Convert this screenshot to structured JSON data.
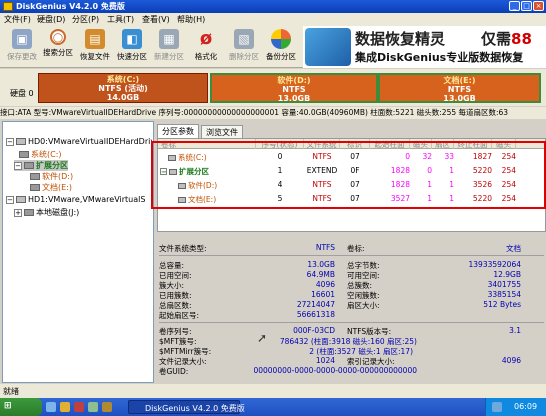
{
  "window": {
    "title": "DiskGenius V4.2.0 免费版"
  },
  "menu": [
    "文件(F)",
    "硬盘(D)",
    "分区(P)",
    "工具(T)",
    "查看(V)",
    "帮助(H)"
  ],
  "toolbar": [
    {
      "label": "保存更改",
      "icon": "save-icon",
      "color": "#8fa5c6",
      "enabled": false
    },
    {
      "label": "搜索分区",
      "icon": "magnifier-icon",
      "color": "#c96a2e",
      "enabled": true
    },
    {
      "label": "恢复文件",
      "icon": "folder-recover-icon",
      "color": "#d38b2c",
      "enabled": true
    },
    {
      "label": "快速分区",
      "icon": "quick-partition-icon",
      "color": "#3a8fd3",
      "enabled": true
    },
    {
      "label": "新建分区",
      "icon": "new-partition-icon",
      "color": "#9aa7b4",
      "enabled": false
    },
    {
      "label": "格式化",
      "icon": "format-icon",
      "color": "#d32020",
      "enabled": true
    },
    {
      "label": "删除分区",
      "icon": "delete-partition-icon",
      "color": "#9aa7b4",
      "enabled": false
    },
    {
      "label": "备份分区",
      "icon": "backup-partition-icon",
      "color": "#d4a31c",
      "enabled": true
    }
  ],
  "banner": {
    "line1": "数据恢复精灵",
    "line2_a": "仅需",
    "line2_b": "88",
    "line3": "集成DiskGenius专业版数据恢复"
  },
  "diskmap": {
    "disk_label": "硬盘 0",
    "partitions": [
      {
        "name": "系统(C:)",
        "fs": "NTFS (活动)",
        "size": "14.0GB",
        "color": "#c0531c"
      },
      {
        "name": "软件(D:)",
        "fs": "NTFS",
        "size": "13.0GB",
        "color": "#d6621e"
      },
      {
        "name": "文档(E:)",
        "fs": "NTFS",
        "size": "13.0GB",
        "color": "#d6621e"
      }
    ]
  },
  "infoline": "接口:ATA  型号:VMwareVirtualIDEHardDrive  序列号:00000000000000000001  容量:40.0GB(40960MB)  柱面数:5221  磁头数:255  每道扇区数:63",
  "tree": {
    "disk0": "HD0:VMwareVirtualIDEHardDrive",
    "c": "系统(C:)",
    "ext": "扩展分区",
    "d": "软件(D:)",
    "e": "文档(E:)",
    "disk1": "HD1:VMware,VMwareVirtualS",
    "local": "本地磁盘(J:)"
  },
  "tabs": [
    "分区参数",
    "浏览文件"
  ],
  "grid": {
    "headers": [
      "卷标",
      "序号(状态)",
      "文件系统",
      "标识",
      "起始柱面",
      "磁头",
      "扇区",
      "终止柱面",
      "磁头"
    ],
    "rows": [
      {
        "name": "系统(C:)",
        "no": "0",
        "fs": "NTFS",
        "id": "07",
        "sc": "0",
        "sh": "32",
        "ss": "33",
        "ec": "1827",
        "eh": "254"
      },
      {
        "name": "扩展分区",
        "no": "1",
        "fs": "EXTEND",
        "id": "0F",
        "sc": "1828",
        "sh": "0",
        "ss": "1",
        "ec": "5220",
        "eh": "254"
      },
      {
        "name": "软件(D:)",
        "no": "4",
        "fs": "NTFS",
        "id": "07",
        "sc": "1828",
        "sh": "1",
        "ss": "1",
        "ec": "3526",
        "eh": "254"
      },
      {
        "name": "文档(E:)",
        "no": "5",
        "fs": "NTFS",
        "id": "07",
        "sc": "3527",
        "sh": "1",
        "ss": "1",
        "ec": "5220",
        "eh": "254"
      }
    ]
  },
  "details": {
    "fs_type_label": "文件系统类型:",
    "fs_type": "NTFS",
    "vol_label": "卷标:",
    "vol": "文档",
    "rows1": [
      {
        "l": "总容量:",
        "v": "13.0GB",
        "l2": "总字节数:",
        "v2": "13933592064"
      },
      {
        "l": "已用空间:",
        "v": "64.9MB",
        "l2": "可用空间:",
        "v2": "12.9GB"
      },
      {
        "l": "簇大小:",
        "v": "4096",
        "l2": "总簇数:",
        "v2": "3401755"
      },
      {
        "l": "已用簇数:",
        "v": "16601",
        "l2": "空闲簇数:",
        "v2": "3385154"
      },
      {
        "l": "总扇区数:",
        "v": "27214047",
        "l2": "扇区大小:",
        "v2": "512 Bytes"
      },
      {
        "l": "起始扇区号:",
        "v": "56661318",
        "l2": "",
        "v2": ""
      }
    ],
    "rows2": [
      {
        "l": "卷序列号:",
        "v": "000F-03CD",
        "l2": "NTFS版本号:",
        "v2": "3.1"
      },
      {
        "l": "$MFT簇号:",
        "v": "786432 (柱面:3918 磁头:160 扇区:25)",
        "l2": "",
        "v2": ""
      },
      {
        "l": "$MFTMirr簇号:",
        "v": "2 (柱面:3527 磁头:1 扇区:17)",
        "l2": "",
        "v2": ""
      },
      {
        "l": "文件记录大小:",
        "v": "1024",
        "l2": "索引记录大小:",
        "v2": "4096"
      },
      {
        "l": "卷GUID:",
        "v": "00000000-0000-0000-0000-000000000000",
        "l2": "",
        "v2": ""
      }
    ]
  },
  "status": "就绪",
  "taskbar": {
    "task": "DiskGenius V4.2.0 免费版",
    "clock": "06:09"
  }
}
